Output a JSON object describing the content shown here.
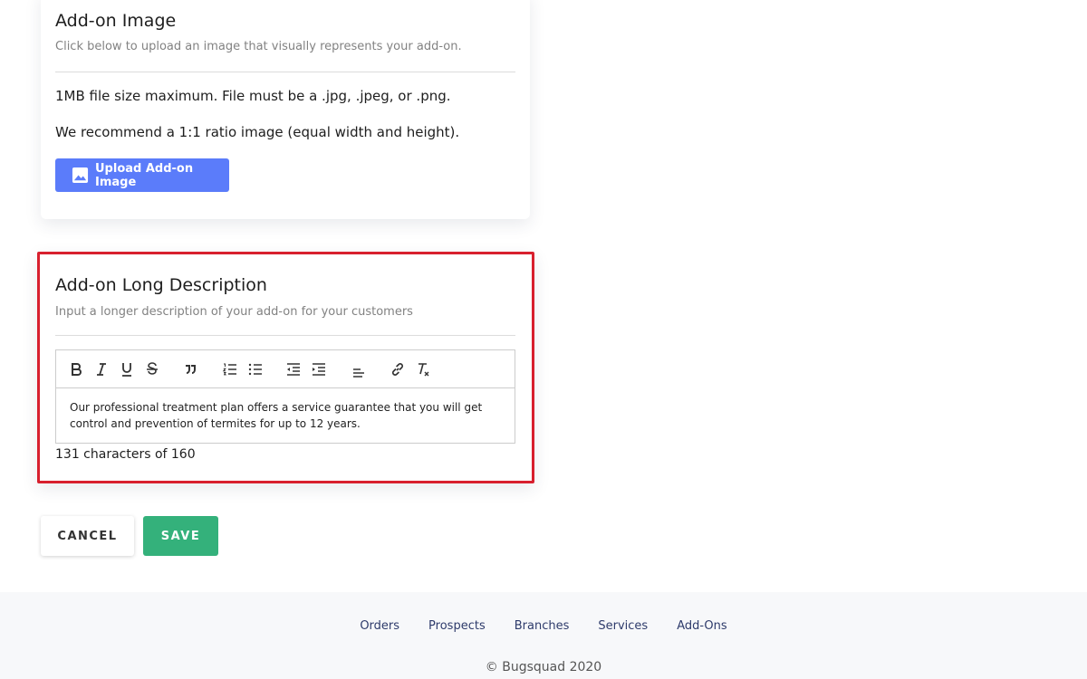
{
  "image_card": {
    "title": "Add-on Image",
    "subtitle": "Click below to upload an image that visually represents your add-on.",
    "size_note": "1MB file size maximum. File must be a .jpg, .jpeg, or .png.",
    "ratio_note": "We recommend a 1:1 ratio image (equal width and height).",
    "upload_label": "Upload Add-on Image",
    "upload_color": "#5b7cfa"
  },
  "description_card": {
    "title": "Add-on Long Description",
    "subtitle": "Input a longer description of your add-on for your customers",
    "highlight_color": "#d8202e",
    "toolbar_icons": [
      "bold-icon",
      "italic-icon",
      "underline-icon",
      "strikethrough-icon",
      "blockquote-icon",
      "ordered-list-icon",
      "bullet-list-icon",
      "outdent-icon",
      "indent-icon",
      "align-icon",
      "link-icon",
      "clear-format-icon"
    ],
    "editor_text": "Our professional treatment plan offers a service guarantee that you will get control and prevention of termites for up to 12 years.",
    "char_count": "131 characters of 160"
  },
  "actions": {
    "cancel_label": "CANCEL",
    "save_label": "SAVE",
    "save_color": "#34b17b"
  },
  "footer": {
    "links": [
      "Orders",
      "Prospects",
      "Branches",
      "Services",
      "Add-Ons"
    ],
    "copyright": "© Bugsquad 2020"
  }
}
